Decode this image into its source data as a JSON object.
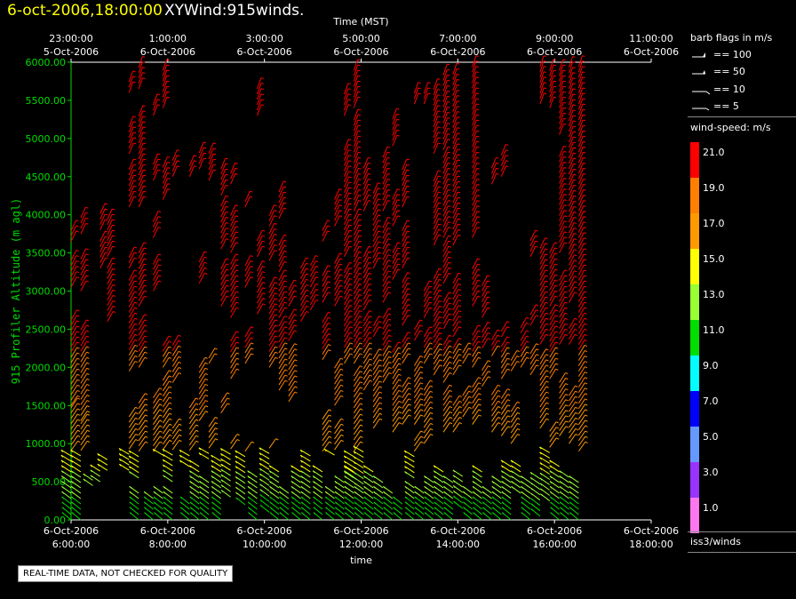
{
  "header": {
    "date_label": "6-oct-2006,18:00:00",
    "title": "XYWind:915winds."
  },
  "chart_data": {
    "type": "wind-barb-time-height",
    "top_axis_title": "Time (MST)",
    "top_ticks": [
      {
        "time": "23:00:00",
        "date": "5-Oct-2006"
      },
      {
        "time": "1:00:00",
        "date": "6-Oct-2006"
      },
      {
        "time": "3:00:00",
        "date": "6-Oct-2006"
      },
      {
        "time": "5:00:00",
        "date": "6-Oct-2006"
      },
      {
        "time": "7:00:00",
        "date": "6-Oct-2006"
      },
      {
        "time": "9:00:00",
        "date": "6-Oct-2006"
      },
      {
        "time": "11:00:00",
        "date": "6-Oct-2006"
      }
    ],
    "bottom_axis_title": "time",
    "bottom_ticks": [
      {
        "date": "6-Oct-2006",
        "time": "6:00:00"
      },
      {
        "date": "6-Oct-2006",
        "time": "8:00:00"
      },
      {
        "date": "6-Oct-2006",
        "time": "10:00:00"
      },
      {
        "date": "6-Oct-2006",
        "time": "12:00:00"
      },
      {
        "date": "6-Oct-2006",
        "time": "14:00:00"
      },
      {
        "date": "6-Oct-2006",
        "time": "16:00:00"
      },
      {
        "date": "6-Oct-2006",
        "time": "18:00:00"
      }
    ],
    "x_range_hours": [
      6,
      18
    ],
    "y_axis_title": "915 Profiler Altitude (m agl)",
    "y_range": [
      0,
      6000
    ],
    "y_ticks": [
      "0.00",
      "500.00",
      "1000.00",
      "1500.00",
      "2000.00",
      "2500.00",
      "3000.00",
      "3500.00",
      "4000.00",
      "4500.00",
      "5000.00",
      "5500.00",
      "6000.00"
    ],
    "profiles": [
      {
        "t": 6.0,
        "segs": [
          [
            0,
            1500
          ],
          [
            1500,
            2650
          ],
          [
            3050,
            3400
          ],
          [
            3650,
            3800
          ]
        ]
      },
      {
        "t": 6.2,
        "segs": [
          [
            0,
            1300
          ],
          [
            1300,
            2550
          ],
          [
            3000,
            3450
          ],
          [
            3750,
            4000
          ]
        ]
      },
      {
        "t": 6.45,
        "segs": [
          [
            450,
            550
          ]
        ]
      },
      {
        "t": 6.6,
        "segs": [
          [
            500,
            650
          ],
          [
            3300,
            3700
          ],
          [
            3800,
            4050
          ]
        ]
      },
      {
        "t": 6.75,
        "segs": [
          [
            650,
            850
          ],
          [
            2600,
            3300
          ],
          [
            3450,
            3950
          ]
        ]
      },
      {
        "t": 7.2,
        "segs": [
          [
            650,
            1350
          ],
          [
            1950,
            3150
          ],
          [
            3300,
            3450
          ],
          [
            4100,
            4600
          ],
          [
            4800,
            5200
          ],
          [
            5600,
            5750
          ]
        ]
      },
      {
        "t": 7.4,
        "segs": [
          [
            0,
            350
          ],
          [
            550,
            1550
          ],
          [
            2000,
            2600
          ],
          [
            2800,
            3550
          ],
          [
            4100,
            5300
          ],
          [
            5650,
            5950
          ]
        ]
      },
      {
        "t": 7.7,
        "segs": [
          [
            0,
            300
          ],
          [
            900,
            1650
          ],
          [
            3000,
            3400
          ],
          [
            3700,
            3950
          ],
          [
            4450,
            4700
          ],
          [
            5300,
            5500
          ]
        ]
      },
      {
        "t": 7.9,
        "segs": [
          [
            0,
            400
          ],
          [
            850,
            1850
          ],
          [
            2000,
            2300
          ],
          [
            4200,
            4650
          ],
          [
            5400,
            5950
          ]
        ]
      },
      {
        "t": 8.1,
        "segs": [
          [
            0,
            350
          ],
          [
            500,
            1200
          ],
          [
            1800,
            2300
          ],
          [
            4500,
            4750
          ]
        ]
      },
      {
        "t": 8.45,
        "segs": [
          [
            0,
            250
          ],
          [
            700,
            1500
          ],
          [
            4500,
            4650
          ]
        ]
      },
      {
        "t": 8.65,
        "segs": [
          [
            0,
            700
          ],
          [
            1300,
            2050
          ],
          [
            3100,
            3400
          ],
          [
            4600,
            4850
          ]
        ]
      },
      {
        "t": 8.85,
        "segs": [
          [
            0,
            550
          ],
          [
            800,
            1250
          ],
          [
            2050,
            2150
          ],
          [
            4450,
            4800
          ]
        ]
      },
      {
        "t": 9.1,
        "segs": [
          [
            0,
            800
          ],
          [
            1400,
            1600
          ],
          [
            2800,
            3350
          ],
          [
            3550,
            4150
          ],
          [
            4250,
            4600
          ]
        ]
      },
      {
        "t": 9.3,
        "segs": [
          [
            300,
            1000
          ],
          [
            1850,
            2350
          ],
          [
            2650,
            3350
          ],
          [
            3500,
            4050
          ],
          [
            4400,
            4600
          ]
        ]
      },
      {
        "t": 9.6,
        "segs": [
          [
            200,
            900
          ],
          [
            2050,
            2400
          ],
          [
            3050,
            3350
          ],
          [
            4100,
            4200
          ]
        ]
      },
      {
        "t": 9.85,
        "segs": [
          [
            0,
            600
          ],
          [
            2700,
            3300
          ],
          [
            3450,
            3700
          ],
          [
            5300,
            5700
          ]
        ]
      },
      {
        "t": 10.1,
        "segs": [
          [
            100,
            1000
          ],
          [
            2000,
            3100
          ],
          [
            3400,
            3800
          ],
          [
            3850,
            4050
          ]
        ]
      },
      {
        "t": 10.3,
        "segs": [
          [
            0,
            650
          ],
          [
            1700,
            2550
          ],
          [
            2650,
            3150
          ],
          [
            3250,
            3600
          ],
          [
            3950,
            4350
          ]
        ]
      },
      {
        "t": 10.5,
        "segs": [
          [
            0,
            350
          ],
          [
            1550,
            2200
          ],
          [
            2350,
            2650
          ],
          [
            2800,
            3050
          ]
        ]
      },
      {
        "t": 10.75,
        "segs": [
          [
            0,
            650
          ],
          [
            2600,
            3350
          ]
        ]
      },
      {
        "t": 10.95,
        "segs": [
          [
            0,
            900
          ],
          [
            2750,
            3000
          ],
          [
            3050,
            3350
          ]
        ]
      },
      {
        "t": 11.2,
        "segs": [
          [
            0,
            650
          ],
          [
            900,
            1350
          ],
          [
            2100,
            2600
          ],
          [
            2850,
            3200
          ],
          [
            3650,
            3850
          ]
        ]
      },
      {
        "t": 11.45,
        "segs": [
          [
            0,
            350
          ],
          [
            850,
            1250
          ],
          [
            1500,
            2050
          ],
          [
            2800,
            3400
          ],
          [
            3850,
            4200
          ]
        ]
      },
      {
        "t": 11.65,
        "segs": [
          [
            0,
            500
          ],
          [
            2050,
            3300
          ],
          [
            3450,
            4900
          ],
          [
            5300,
            5600
          ]
        ]
      },
      {
        "t": 11.85,
        "segs": [
          [
            0,
            650
          ],
          [
            550,
            1000
          ],
          [
            1050,
            1900
          ],
          [
            2050,
            4000
          ],
          [
            4050,
            5300
          ],
          [
            5400,
            5950
          ]
        ]
      },
      {
        "t": 12.05,
        "segs": [
          [
            0,
            350
          ],
          [
            400,
            950
          ],
          [
            1700,
            2650
          ],
          [
            2750,
            3450
          ],
          [
            4050,
            4650
          ]
        ]
      },
      {
        "t": 12.25,
        "segs": [
          [
            0,
            650
          ],
          [
            1200,
            2150
          ],
          [
            2400,
            2600
          ],
          [
            3300,
            4300
          ]
        ]
      },
      {
        "t": 12.45,
        "segs": [
          [
            0,
            500
          ],
          [
            1800,
            2700
          ],
          [
            2850,
            3850
          ],
          [
            4050,
            4800
          ]
        ]
      },
      {
        "t": 12.65,
        "segs": [
          [
            0,
            350
          ],
          [
            1150,
            2200
          ],
          [
            3150,
            3550
          ],
          [
            3850,
            4200
          ],
          [
            4900,
            5300
          ]
        ]
      },
      {
        "t": 12.85,
        "segs": [
          [
            0,
            250
          ],
          [
            1250,
            1800
          ],
          [
            2050,
            2350
          ],
          [
            2550,
            3150
          ],
          [
            3300,
            3850
          ],
          [
            4100,
            4650
          ]
        ]
      },
      {
        "t": 13.1,
        "segs": [
          [
            0,
            450
          ],
          [
            550,
            1050
          ],
          [
            1250,
            2050
          ],
          [
            2350,
            2550
          ],
          [
            5450,
            5650
          ]
        ]
      },
      {
        "t": 13.3,
        "segs": [
          [
            0,
            350
          ],
          [
            1000,
            1700
          ],
          [
            2050,
            2450
          ],
          [
            2650,
            3000
          ],
          [
            5450,
            5600
          ]
        ]
      },
      {
        "t": 13.5,
        "segs": [
          [
            0,
            550
          ],
          [
            1900,
            3200
          ],
          [
            3600,
            4500
          ],
          [
            4800,
            5700
          ]
        ]
      },
      {
        "t": 13.7,
        "segs": [
          [
            0,
            650
          ],
          [
            1150,
            1650
          ],
          [
            1800,
            2300
          ],
          [
            2500,
            2850
          ],
          [
            3100,
            3600
          ],
          [
            3700,
            4750
          ],
          [
            4850,
            5850
          ]
        ]
      },
      {
        "t": 13.9,
        "segs": [
          [
            0,
            500
          ],
          [
            1150,
            1500
          ],
          [
            1900,
            2250
          ],
          [
            2400,
            3150
          ],
          [
            3600,
            5900
          ]
        ]
      },
      {
        "t": 14.1,
        "segs": [
          [
            150,
            600
          ],
          [
            1350,
            1650
          ],
          [
            2050,
            2250
          ]
        ]
      },
      {
        "t": 14.3,
        "segs": [
          [
            0,
            400
          ],
          [
            1250,
            1750
          ],
          [
            2000,
            2450
          ],
          [
            2800,
            3350
          ],
          [
            3700,
            5950
          ]
        ]
      },
      {
        "t": 14.5,
        "segs": [
          [
            0,
            650
          ],
          [
            1750,
            2000
          ],
          [
            2250,
            2500
          ],
          [
            2650,
            3100
          ]
        ]
      },
      {
        "t": 14.7,
        "segs": [
          [
            0,
            400
          ],
          [
            1150,
            1700
          ],
          [
            2150,
            2400
          ],
          [
            4400,
            4650
          ]
        ]
      },
      {
        "t": 14.9,
        "segs": [
          [
            0,
            500
          ],
          [
            1100,
            1650
          ],
          [
            1850,
            2300
          ],
          [
            2400,
            2500
          ],
          [
            4500,
            4800
          ]
        ]
      },
      {
        "t": 15.1,
        "segs": [
          [
            0,
            750
          ],
          [
            1000,
            1450
          ],
          [
            1950,
            2100
          ]
        ]
      },
      {
        "t": 15.3,
        "segs": [
          [
            350,
            700
          ],
          [
            2000,
            2350
          ],
          [
            2450,
            2550
          ]
        ]
      },
      {
        "t": 15.5,
        "segs": [
          [
            0,
            500
          ],
          [
            1900,
            2200
          ],
          [
            2550,
            2700
          ],
          [
            3450,
            3700
          ]
        ]
      },
      {
        "t": 15.7,
        "segs": [
          [
            50,
            600
          ],
          [
            1200,
            2150
          ],
          [
            2300,
            3600
          ],
          [
            5450,
            5950
          ]
        ]
      },
      {
        "t": 15.9,
        "segs": [
          [
            250,
            1200
          ],
          [
            1850,
            2750
          ],
          [
            2800,
            3550
          ],
          [
            5400,
            5950
          ]
        ]
      },
      {
        "t": 16.1,
        "segs": [
          [
            0,
            700
          ],
          [
            1100,
            1850
          ],
          [
            2300,
            3200
          ],
          [
            3500,
            4800
          ],
          [
            5050,
            5900
          ]
        ]
      },
      {
        "t": 16.3,
        "segs": [
          [
            0,
            600
          ],
          [
            1000,
            1650
          ],
          [
            2300,
            2550
          ],
          [
            2850,
            5950
          ]
        ]
      },
      {
        "t": 16.5,
        "segs": [
          [
            0,
            500
          ],
          [
            900,
            5950
          ]
        ]
      }
    ]
  },
  "legend": {
    "barb_title": "barb flags in m/s",
    "barb_items": [
      "== 100",
      "== 50",
      "== 10",
      "== 5"
    ],
    "colorbar_title": "wind-speed: m/s",
    "colorbar": [
      {
        "label": "21.0",
        "color": "#ff0000"
      },
      {
        "label": "19.0",
        "color": "#ff8000"
      },
      {
        "label": "17.0",
        "color": "#ff9900"
      },
      {
        "label": "15.0",
        "color": "#ffff00"
      },
      {
        "label": "13.0",
        "color": "#99ff33"
      },
      {
        "label": "11.0",
        "color": "#00dd00"
      },
      {
        "label": "9.0",
        "color": "#00ffff"
      },
      {
        "label": "7.0",
        "color": "#0000ff"
      },
      {
        "label": "5.0",
        "color": "#6699ff"
      },
      {
        "label": "3.0",
        "color": "#9933ff"
      },
      {
        "label": "1.0",
        "color": "#ff77ee"
      }
    ],
    "station": "iss3/winds"
  },
  "notice": "REAL-TIME DATA, NOT CHECKED FOR QUALITY",
  "colors": {
    "axis": "#00dd00",
    "frame": "#ffffff",
    "text": "#ffffff",
    "header": "#ffff00"
  }
}
